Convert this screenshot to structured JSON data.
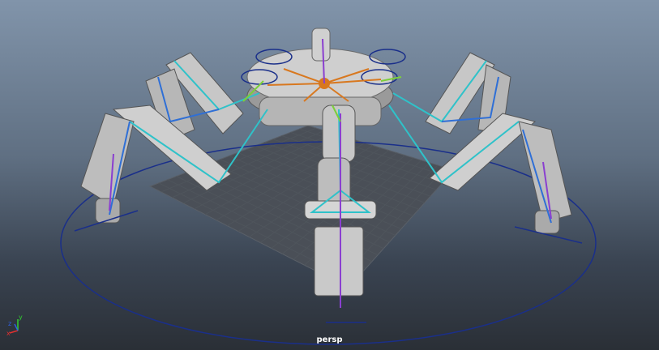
{
  "viewport": {
    "camera_label": "persp",
    "axis_labels": {
      "x": "x",
      "y": "y",
      "z": "z"
    },
    "colors": {
      "sky_top": "#8194aa",
      "floor": "#2a2f36",
      "grid": "#4a4f56",
      "body": "#c9c9c9",
      "control_curve": "#1a2f8a",
      "joint_cyan": "#2fc2c9",
      "joint_green": "#7bcf3a",
      "joint_blue": "#2f6fd6",
      "joint_purple": "#8a3fd0",
      "joint_orange": "#d8781f",
      "axis_x": "#e03030",
      "axis_y": "#30d030",
      "axis_z": "#3060e0"
    }
  }
}
